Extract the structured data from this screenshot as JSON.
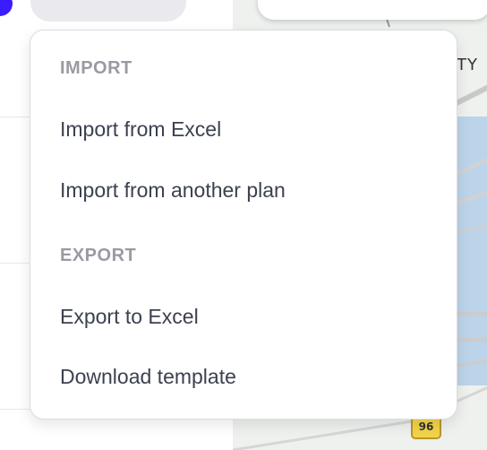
{
  "menu": {
    "sections": [
      {
        "header": "IMPORT",
        "items": [
          "Import from Excel",
          "Import from another plan"
        ]
      },
      {
        "header": "EXPORT",
        "items": [
          "Export to Excel",
          "Download template"
        ]
      }
    ]
  },
  "map": {
    "label": "TY",
    "route_badge": "96"
  },
  "colors": {
    "accent": "#3b1cff",
    "menu_text": "#3c4150",
    "section_header": "#9a9aa4"
  }
}
